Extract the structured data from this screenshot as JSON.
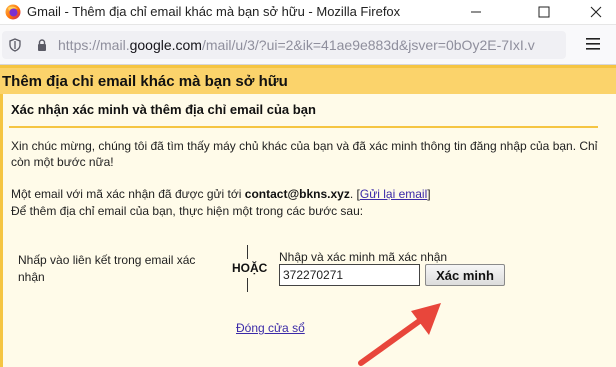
{
  "window": {
    "title": "Gmail - Thêm địa chỉ email khác mà bạn sở hữu - Mozilla Firefox",
    "icons": {
      "app": "firefox-icon",
      "minimize": "minimize-icon",
      "maximize": "maximize-icon",
      "close": "close-icon"
    }
  },
  "navbar": {
    "url_prefix": "https://mail.",
    "url_host": "google.com",
    "url_rest": "/mail/u/3/?ui=2&ik=41ae9e883d&jsver=0bOy2E-7IxI.v",
    "icons": {
      "shield": "shield-icon",
      "lock": "lock-icon",
      "menu": "hamburger-menu-icon"
    }
  },
  "dialog": {
    "header_title": "Thêm địa chỉ email khác mà bạn sở hữu",
    "subtitle": "Xác nhận xác minh và thêm địa chỉ email của bạn",
    "congrats": "Xin chúc mừng, chúng tôi đã tìm thấy máy chủ khác của bạn và đã xác minh thông tin đăng nhập của bạn. Chỉ còn một bước nữa!",
    "sent_prefix": "Một email với mã xác nhận đã được gửi tới ",
    "sent_email": "contact@bkns.xyz",
    "sent_mid": ". [",
    "resend_link": "Gửi lại email",
    "sent_suffix": "]",
    "instruction": "Để thêm địa chỉ email của bạn, thực hiện một trong các bước sau:",
    "option_link_label": "Nhấp vào liên kết trong email xác nhận",
    "or_label": "HOẶC",
    "code_label": "Nhập và xác minh mã xác nhận",
    "code_value": "372270271",
    "verify_button": "Xác minh",
    "close_link": "Đóng cửa sổ"
  },
  "colors": {
    "header_bg": "#fbd36b",
    "accent_line": "#f5c542",
    "content_bg": "#fffbe9",
    "link": "#3b2aa8",
    "arrow": "#e8463b"
  }
}
